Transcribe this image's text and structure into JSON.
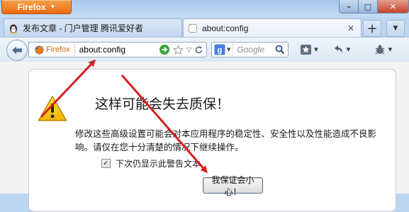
{
  "window": {
    "app_menu_label": "Firefox",
    "controls": {
      "minimize": "–",
      "maximize": "□",
      "close": "✕"
    }
  },
  "tabs": [
    {
      "label": "发布文章 - 门户管理 腾讯爱好者",
      "icon": "qq-penguin-icon",
      "active": false
    },
    {
      "label": "about:config",
      "icon": "blank-page-icon",
      "active": true
    }
  ],
  "tabstrip": {
    "new_tab": "+",
    "list_tabs": "▼"
  },
  "navbar": {
    "identity_label": "Firefox",
    "url": "about:config",
    "search_placeholder": "Google",
    "search_engine_icon": "google-g-icon"
  },
  "warning": {
    "title": "这样可能会失去质保！",
    "description": "修改这些高级设置可能会对本应用程序的稳定性、安全性以及性能造成不良影响。请仅在您十分清楚的情况下继续操作。",
    "checkbox_label": "下次仍显示此警告文本",
    "checkbox_checked": true,
    "button_label": "我保证会小心！"
  },
  "colors": {
    "firefox_orange": "#e96a0f",
    "annotation_arrow": "#d42020",
    "warning_yellow": "#f2c200"
  }
}
